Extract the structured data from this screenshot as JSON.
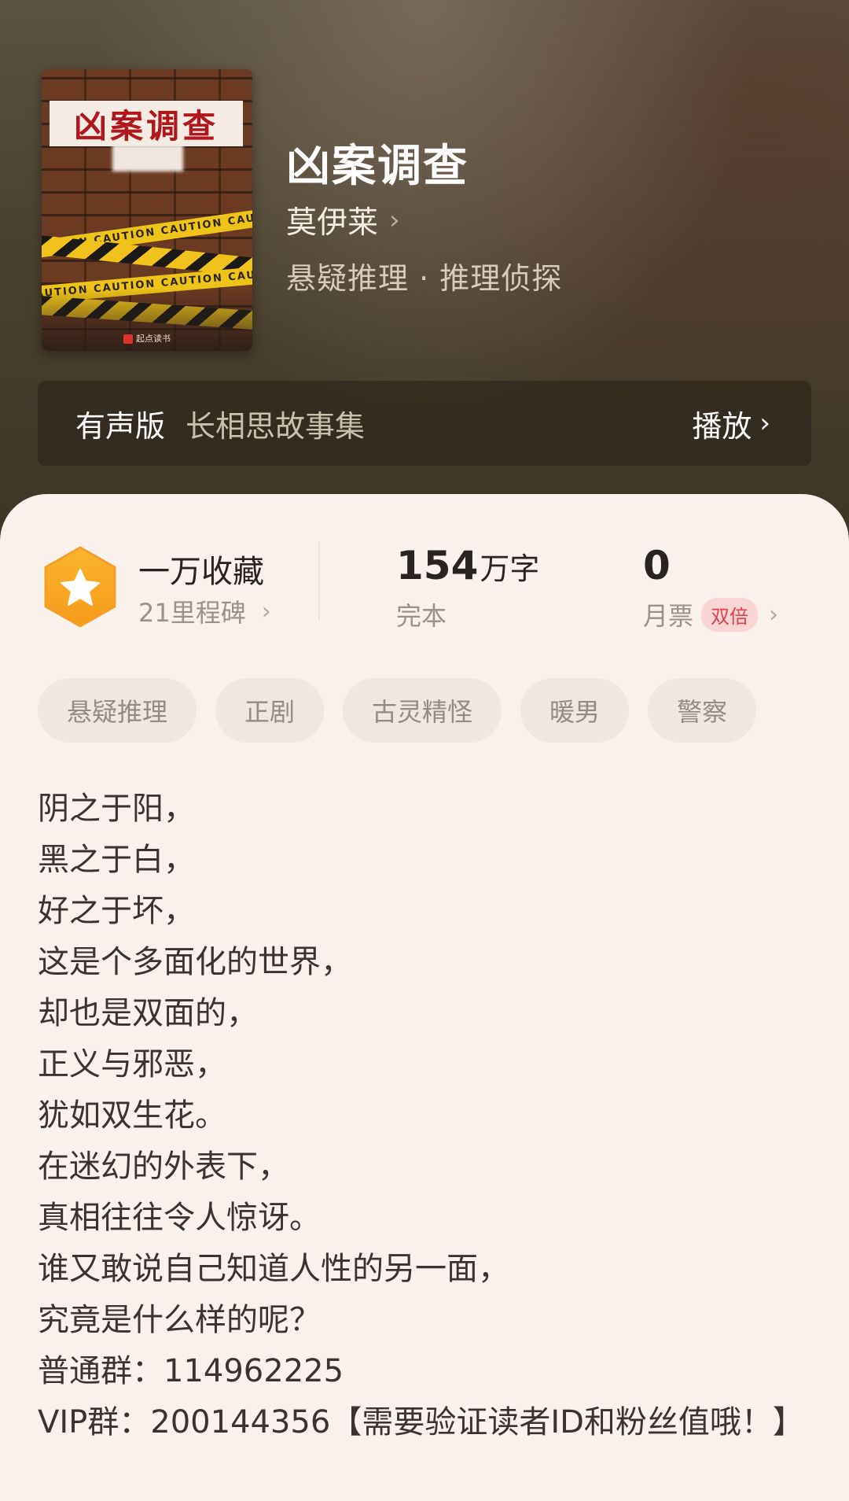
{
  "book": {
    "cover_title": "凶案调查",
    "cover_tape": "CAUTION   CAUTION   CAUTION   CAUTION",
    "cover_publisher": "起点读书",
    "title": "凶案调查",
    "author": "莫伊莱",
    "category": "悬疑推理 · 推理侦探"
  },
  "audio": {
    "label": "有声版",
    "name": "长相思故事集",
    "play_label": "播放"
  },
  "stats": {
    "collect_main": "一万收藏",
    "collect_sub": "21里程碑",
    "words_num": "154",
    "words_unit": "万字",
    "words_sub": "完本",
    "monthly_num": "0",
    "monthly_sub": "月票",
    "monthly_badge": "双倍"
  },
  "tags": [
    "悬疑推理",
    "正剧",
    "古灵精怪",
    "暖男",
    "警察"
  ],
  "synopsis": [
    "阴之于阳，",
    "黑之于白，",
    "好之于坏，",
    "这是个多面化的世界，",
    "却也是双面的，",
    "正义与邪恶，",
    "犹如双生花。",
    "在迷幻的外表下，",
    "真相往往令人惊讶。",
    "谁又敢说自己知道人性的另一面，",
    "究竟是什么样的呢？",
    "普通群：114962225",
    "VIP群：200144356【需要验证读者ID和粉丝值哦！】"
  ],
  "icons": {
    "author_chevron": "chevron-right-icon",
    "play_chevron": "chevron-right-icon",
    "badge": "star-badge-icon"
  },
  "colors": {
    "header_bg": "#4a4030",
    "card_bg": "#fbf1ec",
    "badge_orange": "#f7a623",
    "double_badge_text": "#e0414a"
  }
}
